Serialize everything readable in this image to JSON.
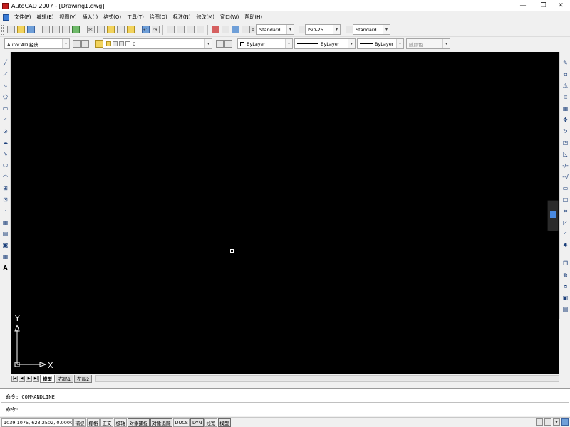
{
  "window": {
    "title": "AutoCAD 2007 - [Drawing1.dwg]",
    "controls": {
      "minimize": "—",
      "restore": "❐",
      "close": "✕"
    }
  },
  "menu": {
    "items": [
      "文件(F)",
      "编辑(E)",
      "视图(V)",
      "插入(I)",
      "格式(O)",
      "工具(T)",
      "绘图(D)",
      "标注(N)",
      "修改(M)",
      "窗口(W)",
      "帮助(H)"
    ]
  },
  "toolbar1": {
    "text_style": "Standard",
    "dim_style": "ISO-25",
    "table_style": "Standard",
    "icons": [
      "new-icon",
      "open-icon",
      "save-icon",
      "print-icon",
      "preview-icon",
      "publish-icon",
      "3d-dwf-icon",
      "cut-icon",
      "copy-icon",
      "paste-icon",
      "match-properties-icon",
      "block-editor-icon",
      "undo-icon",
      "redo-icon",
      "pan-icon",
      "zoom-realtime-icon",
      "zoom-window-icon",
      "zoom-previous-icon",
      "properties-icon",
      "design-center-icon",
      "tool-palettes-icon",
      "sheet-set-icon",
      "markup-icon",
      "quick-calc-icon",
      "help-icon"
    ]
  },
  "toolbar2": {
    "workspace": "AutoCAD 经典",
    "layer": "0",
    "color": "ByLayer",
    "linetype": "ByLayer",
    "lineweight": "ByLayer",
    "plotstyle": "随颜色"
  },
  "canvas": {
    "background": "#000000",
    "ucs_x_label": "X",
    "ucs_y_label": "Y"
  },
  "tabs": {
    "nav": [
      "|◀",
      "◀",
      "▶",
      "▶|"
    ],
    "items": [
      "模型",
      "布局1",
      "布局2"
    ],
    "active": "模型"
  },
  "command": {
    "history": "命令: COMMANDLINE",
    "prompt": "命令:"
  },
  "status": {
    "coords": "1039.1075, 623.2502, 0.0000",
    "buttons": [
      "捕捉",
      "栅格",
      "正交",
      "极轴",
      "对象捕捉",
      "对象追踪",
      "DUCS",
      "DYN",
      "线宽",
      "模型"
    ]
  },
  "left_tools": [
    "line-icon",
    "construction-line-icon",
    "polyline-icon",
    "polygon-icon",
    "rectangle-icon",
    "arc-icon",
    "circle-icon",
    "revision-cloud-icon",
    "spline-icon",
    "ellipse-icon",
    "ellipse-arc-icon",
    "insert-block-icon",
    "make-block-icon",
    "point-icon",
    "hatch-icon",
    "gradient-icon",
    "region-icon",
    "table-icon",
    "multiline-text-icon"
  ],
  "right_tools": [
    "erase-icon",
    "copy-object-icon",
    "mirror-icon",
    "offset-icon",
    "array-icon",
    "move-icon",
    "rotate-icon",
    "scale-icon",
    "stretch-icon",
    "trim-icon",
    "extend-icon",
    "break-at-point-icon",
    "break-icon",
    "join-icon",
    "chamfer-icon",
    "fillet-icon",
    "explode-icon",
    "draw-order-icon",
    "bring-front-icon",
    "send-back-icon",
    "layer-icon",
    "text-above-icon"
  ]
}
